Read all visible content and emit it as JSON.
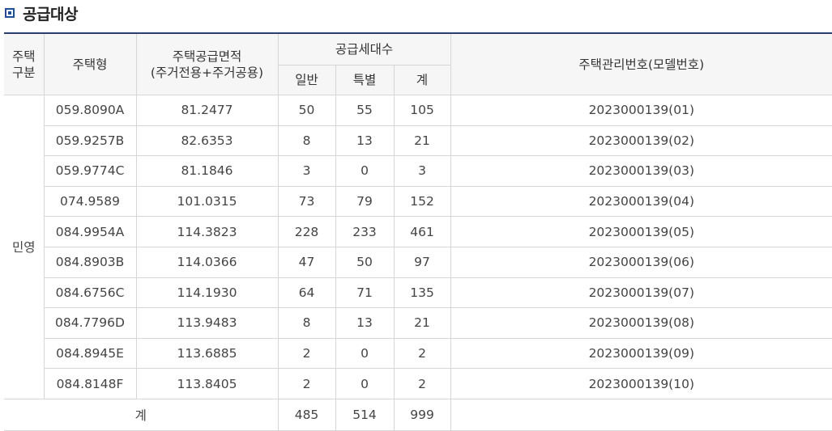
{
  "section_title": "공급대상",
  "headers": {
    "category": "주택\n구분",
    "type": "주택형",
    "area_line1": "주택공급면적",
    "area_line2": "(주거전용+주거공용)",
    "units": "공급세대수",
    "general": "일반",
    "special": "특별",
    "sum": "계",
    "model_no": "주택관리번호(모델번호)"
  },
  "category_value": "민영",
  "rows": [
    {
      "type": "059.8090A",
      "area": "81.2477",
      "general": "50",
      "special": "55",
      "sum": "105",
      "model_no": "2023000139(01)"
    },
    {
      "type": "059.9257B",
      "area": "82.6353",
      "general": "8",
      "special": "13",
      "sum": "21",
      "model_no": "2023000139(02)"
    },
    {
      "type": "059.9774C",
      "area": "81.1846",
      "general": "3",
      "special": "0",
      "sum": "3",
      "model_no": "2023000139(03)"
    },
    {
      "type": "074.9589",
      "area": "101.0315",
      "general": "73",
      "special": "79",
      "sum": "152",
      "model_no": "2023000139(04)"
    },
    {
      "type": "084.9954A",
      "area": "114.3823",
      "general": "228",
      "special": "233",
      "sum": "461",
      "model_no": "2023000139(05)"
    },
    {
      "type": "084.8903B",
      "area": "114.0366",
      "general": "47",
      "special": "50",
      "sum": "97",
      "model_no": "2023000139(06)"
    },
    {
      "type": "084.6756C",
      "area": "114.1930",
      "general": "64",
      "special": "71",
      "sum": "135",
      "model_no": "2023000139(07)"
    },
    {
      "type": "084.7796D",
      "area": "113.9483",
      "general": "8",
      "special": "13",
      "sum": "21",
      "model_no": "2023000139(08)"
    },
    {
      "type": "084.8945E",
      "area": "113.6885",
      "general": "2",
      "special": "0",
      "sum": "2",
      "model_no": "2023000139(09)"
    },
    {
      "type": "084.8148F",
      "area": "113.8405",
      "general": "2",
      "special": "0",
      "sum": "2",
      "model_no": "2023000139(10)"
    }
  ],
  "total": {
    "label": "계",
    "general": "485",
    "special": "514",
    "sum": "999",
    "model_no": ""
  }
}
